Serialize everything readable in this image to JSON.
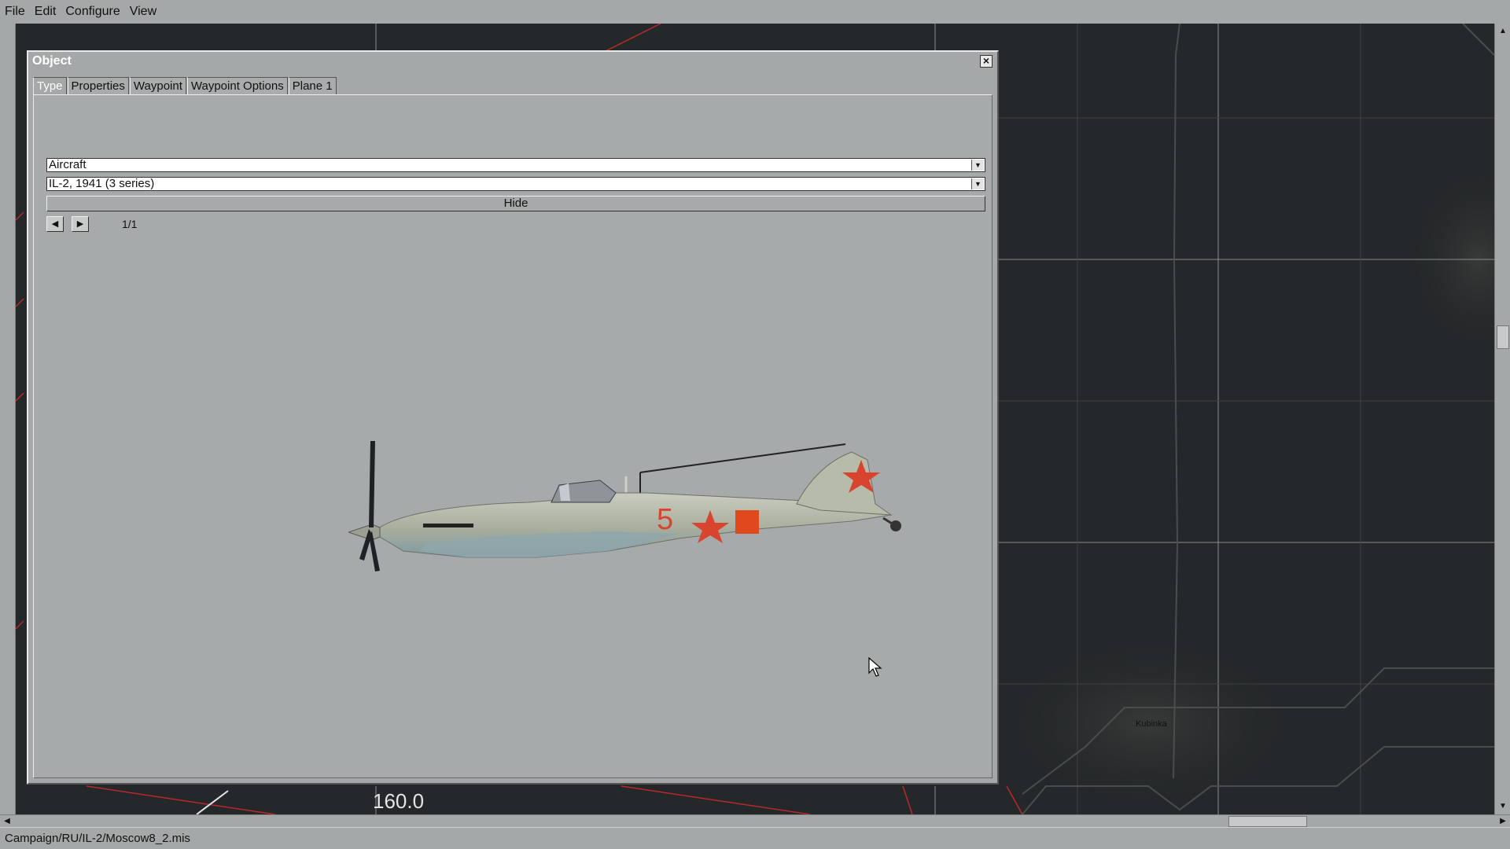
{
  "menubar": {
    "items": [
      {
        "label": "File"
      },
      {
        "label": "Edit"
      },
      {
        "label": "Configure"
      },
      {
        "label": "View"
      }
    ]
  },
  "map": {
    "grid_label": "160.0",
    "town_label": "Kubinka"
  },
  "dialog": {
    "title": "Object",
    "tabs": [
      {
        "label": "Type",
        "active": true
      },
      {
        "label": "Properties",
        "active": false
      },
      {
        "label": "Waypoint",
        "active": false
      },
      {
        "label": "Waypoint Options",
        "active": false
      },
      {
        "label": "Plane 1",
        "active": false
      }
    ],
    "category_value": "Aircraft",
    "type_value": "IL-2, 1941 (3 series)",
    "hide_label": "Hide",
    "pager": "1/1",
    "preview": {
      "tail_number": "5",
      "insignia_color": "#d8442e"
    }
  },
  "statusbar": {
    "path": "Campaign/RU/IL-2/Moscow8_2.mis"
  }
}
